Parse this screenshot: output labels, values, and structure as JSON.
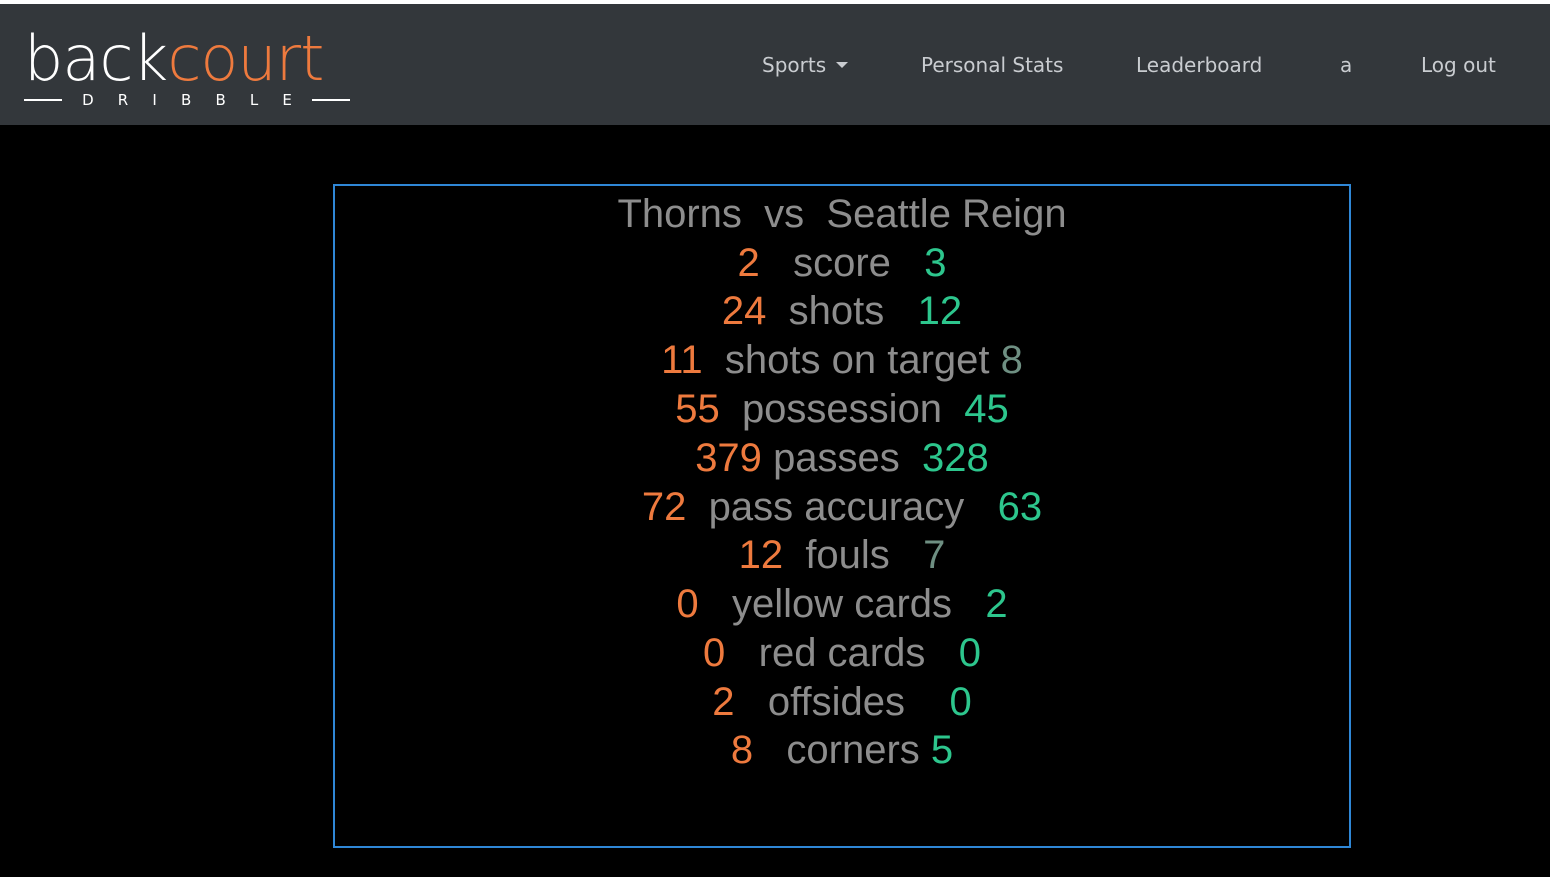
{
  "brand": {
    "logo_word_1": "back",
    "logo_word_2": "court",
    "logo_letters": [
      "D",
      "R",
      "I",
      "B",
      "B",
      "L",
      "E"
    ],
    "colors": {
      "orange": "#ee7a3e",
      "white": "#ffffff"
    }
  },
  "nav": {
    "sports": "Sports",
    "personal_stats": "Personal Stats",
    "leaderboard": "Leaderboard",
    "user": "a",
    "logout": "Log out"
  },
  "match": {
    "home_team": "Thorns",
    "vs": "vs",
    "away_team": "Seattle Reign",
    "colors": {
      "home": "#ee7a3e",
      "away": "#2dc68d",
      "label": "#8d8d8d",
      "border": "#2f87d6"
    },
    "stats": [
      {
        "home": "2",
        "label": "score",
        "away": "3"
      },
      {
        "home": "24",
        "label": "shots",
        "away": "12"
      },
      {
        "home": "11",
        "label": "shots on target",
        "away": "8"
      },
      {
        "home": "55",
        "label": "possession",
        "away": "45"
      },
      {
        "home": "379",
        "label": "passes",
        "away": "328"
      },
      {
        "home": "72",
        "label": "pass accuracy",
        "away": "63"
      },
      {
        "home": "12",
        "label": "fouls",
        "away": "7"
      },
      {
        "home": "0",
        "label": "yellow cards",
        "away": "2"
      },
      {
        "home": "0",
        "label": "red cards",
        "away": "0"
      },
      {
        "home": "2",
        "label": "offsides",
        "away": "0"
      },
      {
        "home": "8",
        "label": "corners",
        "away": "5"
      }
    ]
  }
}
